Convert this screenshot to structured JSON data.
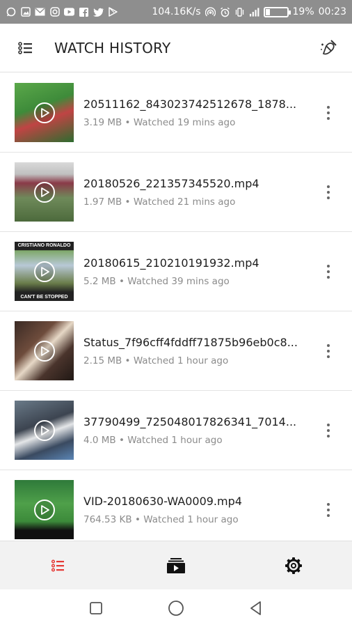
{
  "status_bar": {
    "network_speed": "104.16K/s",
    "battery_percent": "19%",
    "battery_level": 0.19,
    "time": "00:23",
    "notification_icons": [
      "whatsapp-icon",
      "gallery-icon",
      "mail-icon",
      "instagram-icon",
      "youtube-icon",
      "facebook-icon",
      "twitter-icon",
      "playstore-icon"
    ]
  },
  "app_bar": {
    "title": "WATCH HISTORY",
    "menu_icon": "list-icon",
    "action_icon": "clean-history-icon"
  },
  "history": [
    {
      "name": "20511162_843023742512678_1878...",
      "size": "3.19 MB",
      "watched": "Watched 19 mins ago"
    },
    {
      "name": "20180526_221357345520.mp4",
      "size": "1.97 MB",
      "watched": "Watched 21 mins ago"
    },
    {
      "name": "20180615_210210191932.mp4",
      "size": "5.2 MB",
      "watched": "Watched 39 mins ago",
      "thumb_caption_top": "CRISTIANO RONALDO",
      "thumb_caption_bottom": "CAN'T BE STOPPED"
    },
    {
      "name": "Status_7f96cff4fddff71875b96eb0c8...",
      "size": "2.15 MB",
      "watched": "Watched 1 hour ago"
    },
    {
      "name": "37790499_725048017826341_7014...",
      "size": "4.0 MB",
      "watched": "Watched 1 hour ago"
    },
    {
      "name": "VID-20180630-WA0009.mp4",
      "size": "764.53 KB",
      "watched": "Watched 1 hour ago"
    }
  ],
  "meta_separator": " • ",
  "tabs": [
    {
      "name": "history",
      "icon": "history-list-icon",
      "active": true
    },
    {
      "name": "videos",
      "icon": "video-folder-icon",
      "active": false
    },
    {
      "name": "settings",
      "icon": "gear-icon",
      "active": false
    }
  ],
  "colors": {
    "accent": "#e53935",
    "status_bar": "#8e8e8e",
    "secondary_text": "#8b8b8b"
  }
}
